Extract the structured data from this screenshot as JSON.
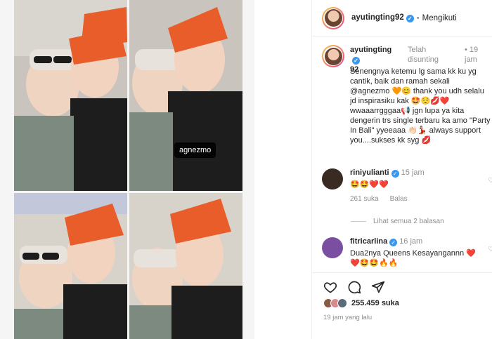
{
  "post": {
    "photo_tag": "agnezmo"
  },
  "header": {
    "username": "ayutingting92",
    "verified_badge": "✓",
    "separator": "•",
    "follow_label": "Mengikuti"
  },
  "caption": {
    "username_line1": "ayutingting",
    "username_line2": "92",
    "edited": "Telah disunting",
    "separator": "•",
    "time": "19 jam",
    "text": "Senengnya ketemu lg sama kk ku yg cantik, baik dan ramah sekali @agnezmo 🧡😊 thank you udh selalu jd inspirasiku kak 🤩😌💋❤️ wwaaarrgggaa📢 jgn lupa ya kita dengerin trs single terbaru ka amo \"Party In Bali\" yyeeaaa 👏🏻💃🏻 always support you....sukses kk syg 💋"
  },
  "comments": [
    {
      "username": "riniyulianti",
      "time": "15 jam",
      "text": "🤩🤩❤️❤️",
      "likes": "261 suka",
      "reply": "Balas",
      "avatar_color": "#3a2a24"
    },
    {
      "username": "fitricarlina",
      "time": "16 jam",
      "text": "Dua2nya Queens Kesayangannn ❤️❤️🤩🤩🔥🔥",
      "avatar_color": "#7a4ea0"
    }
  ],
  "view_replies": "Lihat semua 2 balasan",
  "actions": {
    "likes_count": "255.459 suka",
    "time_ago": "19 jam yang lalu"
  },
  "colors": {
    "verified": "#3897f0",
    "hat": "#e85d2a",
    "muted": "#8e8e8e"
  }
}
